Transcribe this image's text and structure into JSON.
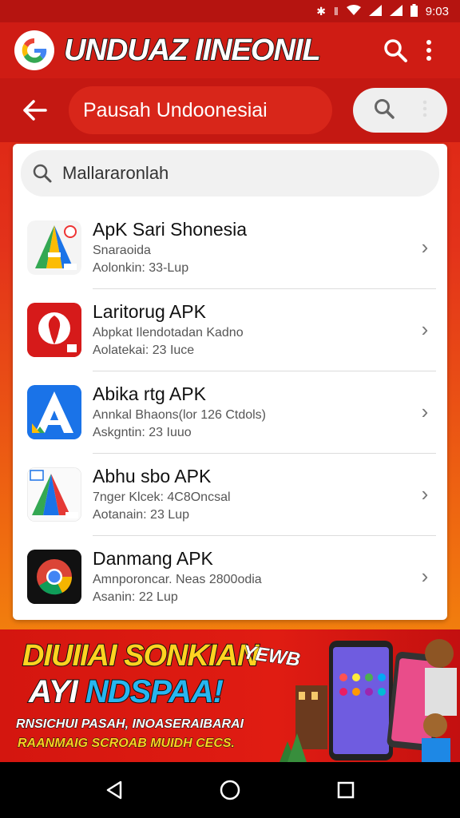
{
  "status_bar": {
    "time": "9:03",
    "icons": [
      "bluetooth-icon",
      "vibrate-icon",
      "wifi-icon",
      "signal-icon",
      "signal-icon",
      "battery-icon"
    ]
  },
  "app_bar": {
    "title": "UNDUAZ IINEONIL",
    "logo": "google-g-icon",
    "actions": [
      "search-icon",
      "more-vert-icon"
    ]
  },
  "sub_bar": {
    "title": "Pausah Undoonesiai",
    "actions": [
      "search-icon",
      "more-vert-icon"
    ]
  },
  "search": {
    "text": "Mallararonlah"
  },
  "apps": [
    {
      "title": "ApK Sari Shonesia",
      "subtitle": "Snaraoida",
      "date": "Aolonkin: 33-Lup",
      "icon": "drive-style-icon"
    },
    {
      "title": "Laritorug APK",
      "subtitle": "Abpkat Ilendotadan Kadno",
      "date": "Aolatekai: 23 Iuce",
      "icon": "red-app-icon"
    },
    {
      "title": "Abika rtg APK",
      "subtitle": "Annkal Bhaons(lor 126 Ctdols)",
      "date": "Askgntin: 23 Iuuo",
      "icon": "blue-a-icon"
    },
    {
      "title": "Abhu sbo APK",
      "subtitle": "7nger Klcek: 4C8Oncsal",
      "date": "Aotanain: 23 Lup",
      "icon": "colorful-a-icon"
    },
    {
      "title": "Danmang APK",
      "subtitle": "Amnporoncar. Neas 2800odia",
      "date": "Asanin: 22 Lup",
      "icon": "chrome-icon"
    }
  ],
  "banner": {
    "line1": "DIUIIAI SONKIAN",
    "line2_a": "AYI ",
    "line2_b": "NDSPAA!",
    "line3": "RNSICHUI PASAH, INOASERAIBARAI",
    "line4": "RAANMAIG SCROAB MUIDH CECS.",
    "tag": "YEWB"
  },
  "nav": [
    "back-triangle-icon",
    "home-circle-icon",
    "recents-square-icon"
  ],
  "colors": {
    "primary_red": "#cf1c14",
    "banner_yellow": "#ffd321",
    "banner_blue": "#27b6f0"
  }
}
